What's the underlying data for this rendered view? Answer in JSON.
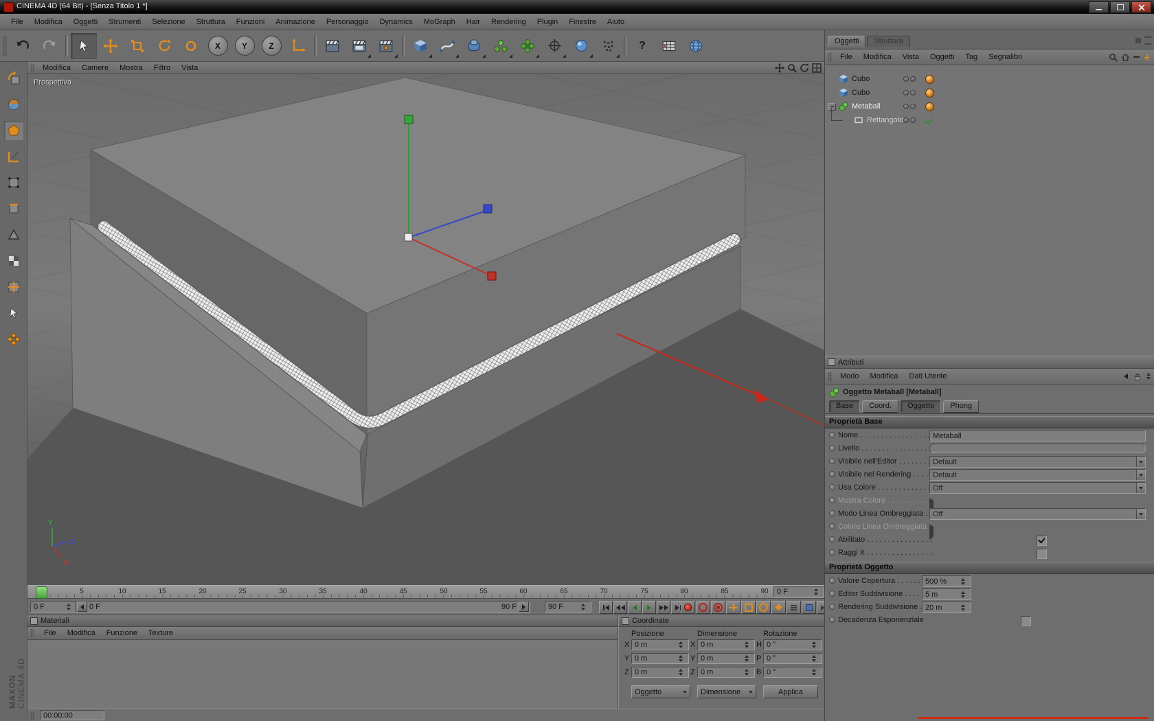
{
  "window": {
    "title": "CINEMA 4D (64 Bit) - [Senza Titolo 1 *]"
  },
  "menu_bar": [
    "File",
    "Modifica",
    "Oggetti",
    "Strumenti",
    "Selezione",
    "Struttura",
    "Funzioni",
    "Animazione",
    "Personaggio",
    "Dynamics",
    "MoGraph",
    "Hair",
    "Rendering",
    "Plugin",
    "Finestre",
    "Aiuto"
  ],
  "toolbar": {
    "lock_x": "X",
    "lock_y": "Y",
    "lock_z": "Z",
    "help": "?"
  },
  "viewport": {
    "menus": [
      "Modifica",
      "Camere",
      "Mostra",
      "Filtro",
      "Vista"
    ],
    "camera_label": "Prospettiva",
    "axis": {
      "x": "X",
      "y": "Y",
      "z": "Z"
    }
  },
  "object_manager": {
    "tabs": [
      "Oggetti",
      "Struttura"
    ],
    "menus": [
      "File",
      "Modifica",
      "Vista",
      "Oggetti",
      "Tag",
      "Segnalibri"
    ],
    "objects": [
      "Cubo",
      "Cubo",
      "Metaball",
      "Rettangolo"
    ]
  },
  "attributes": {
    "panel_title": "Attributi",
    "menus": [
      "Modo",
      "Modifica",
      "Dati Utente"
    ],
    "object_title": "Oggetto Metaball [Metaball]",
    "tabs": [
      "Base",
      "Coord.",
      "Oggetto",
      "Phong"
    ],
    "base": {
      "title": "Proprietà Base",
      "nome_label": "Nome . . . . . . . . . . . . . . . . . . .",
      "nome_value": "Metaball",
      "livello_label": "Livello . . . . . . . . . . . . . . . . . .",
      "vis_editor_label": "Visibile nell'Editor . . . . . . . . .",
      "vis_editor_value": "Default",
      "vis_render_label": "Visibile nel Rendering . . . . . .",
      "vis_render_value": "Default",
      "usa_colore_label": "Usa Colore . . . . . . . . . . . . . .",
      "usa_colore_value": "Off",
      "mostra_colore_label": "Mostra Colore . . . . . . . . . . .",
      "modo_linea_label": "Modo Linea Ombreggiata . . .",
      "modo_linea_value": "Off",
      "colore_linea_label": "Colore Linea Ombreggiata . .",
      "abilitato_label": "Abilitato . . . . . . . . . . . . . . . .",
      "raggi_label": "Raggi X . . . . . . . . . . . . . . . ."
    },
    "oggetto": {
      "title": "Proprietà Oggetto",
      "valore_label": "Valore  Copertura . . . . . . . .",
      "valore_value": "500 %",
      "editor_label": "Editor Suddivisione . . . . . . .",
      "editor_value": "5 m",
      "rendering_label": "Rendering Suddivisione . . .",
      "rendering_value": "20 m",
      "decadenza_label": "Decadenza Esponenziale"
    }
  },
  "timeline": {
    "ticks": [
      "0",
      "5",
      "10",
      "15",
      "20",
      "25",
      "30",
      "35",
      "40",
      "45",
      "50",
      "55",
      "60",
      "65",
      "70",
      "75",
      "80",
      "85",
      "90"
    ],
    "frame_box": "0 F",
    "frame_field": "0 F",
    "range_start": "0 F",
    "range_end": "90 F",
    "end_field": "90 F"
  },
  "materials": {
    "panel_title": "Materiali",
    "menus": [
      "File",
      "Modifica",
      "Funzione",
      "Texture"
    ]
  },
  "coordinates": {
    "panel_title": "Coordinate",
    "columns": [
      "Posizione",
      "Dimensione",
      "Rotazione"
    ],
    "pos": {
      "x_label": "X",
      "x": "0 m",
      "y_label": "Y",
      "y": "0 m",
      "z_label": "Z",
      "z": "0 m"
    },
    "dim": {
      "x_label": "X",
      "x": "0 m",
      "y_label": "Y",
      "y": "0 m",
      "z_label": "Z",
      "z": "0 m"
    },
    "rot": {
      "h_label": "H",
      "h": "0 °",
      "p_label": "P",
      "p": "0 °",
      "b_label": "B",
      "b": "0 °"
    },
    "mode_object": "Oggetto",
    "mode_size": "Dimensione",
    "apply": "Applica"
  },
  "status": {
    "time": "00:00:00"
  },
  "branding": {
    "line1": "MAXON",
    "line2": "CINEMA 4D"
  }
}
